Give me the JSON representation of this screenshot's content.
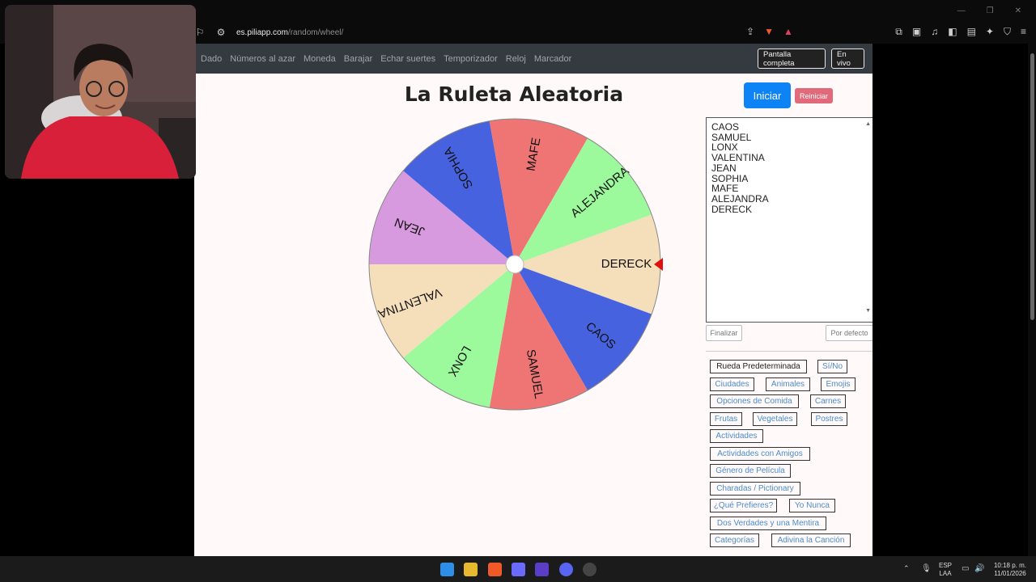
{
  "browser": {
    "url_domain": "es.piliapp.com",
    "url_path": "/random/wheel/"
  },
  "nav": {
    "links": [
      "Dado",
      "Números al azar",
      "Moneda",
      "Barajar",
      "Echar suertes",
      "Temporizador",
      "Reloj",
      "Marcador"
    ],
    "fullscreen_label": "Pantalla completa",
    "live_label": "En vivo"
  },
  "main": {
    "title": "La Ruleta Aleatoria",
    "start_label": "Iniciar",
    "reset_label": "Reiniciar"
  },
  "wheel": {
    "segments": [
      {
        "label": "DERECK",
        "color": "#f5dfbb"
      },
      {
        "label": "CAOS",
        "color": "#4762de"
      },
      {
        "label": "SAMUEL",
        "color": "#ef7575"
      },
      {
        "label": "LONX",
        "color": "#9cfa9c"
      },
      {
        "label": "VALENTINA",
        "color": "#f5dfbb"
      },
      {
        "label": "JEAN",
        "color": "#d89ade"
      },
      {
        "label": "SOPHIA",
        "color": "#4762de"
      },
      {
        "label": "MAFE",
        "color": "#ef7575"
      },
      {
        "label": "ALEJANDRA",
        "color": "#9cfa9c"
      }
    ],
    "pointer_color": "#e01010"
  },
  "entries": {
    "lines": [
      "CAOS",
      "SAMUEL",
      "LONX",
      "VALENTINA",
      "JEAN",
      "SOPHIA",
      "MAFE",
      "ALEJANDRA",
      "DERECK"
    ],
    "finish_label": "Finalizar",
    "default_label": "Por defecto"
  },
  "presets": {
    "items": [
      "Rueda Predeterminada",
      "Sí/No",
      "Ciudades",
      "Animales",
      "Emojis",
      "Opciones de Comida",
      "Carnes",
      "Frutas",
      "Vegetales",
      "Postres",
      "Actividades",
      "Actividades con Amigos",
      "Género de Película",
      "Charadas / Pictionary",
      "¿Qué Prefieres?",
      "Yo Nunca",
      "Dos Verdades y una Mentira",
      "Categorías",
      "Adivina la Canción"
    ]
  },
  "taskbar": {
    "lang_top": "ESP",
    "lang_bottom": "LAA",
    "time": "10:18 p. m.",
    "date": "11/01/2026"
  }
}
